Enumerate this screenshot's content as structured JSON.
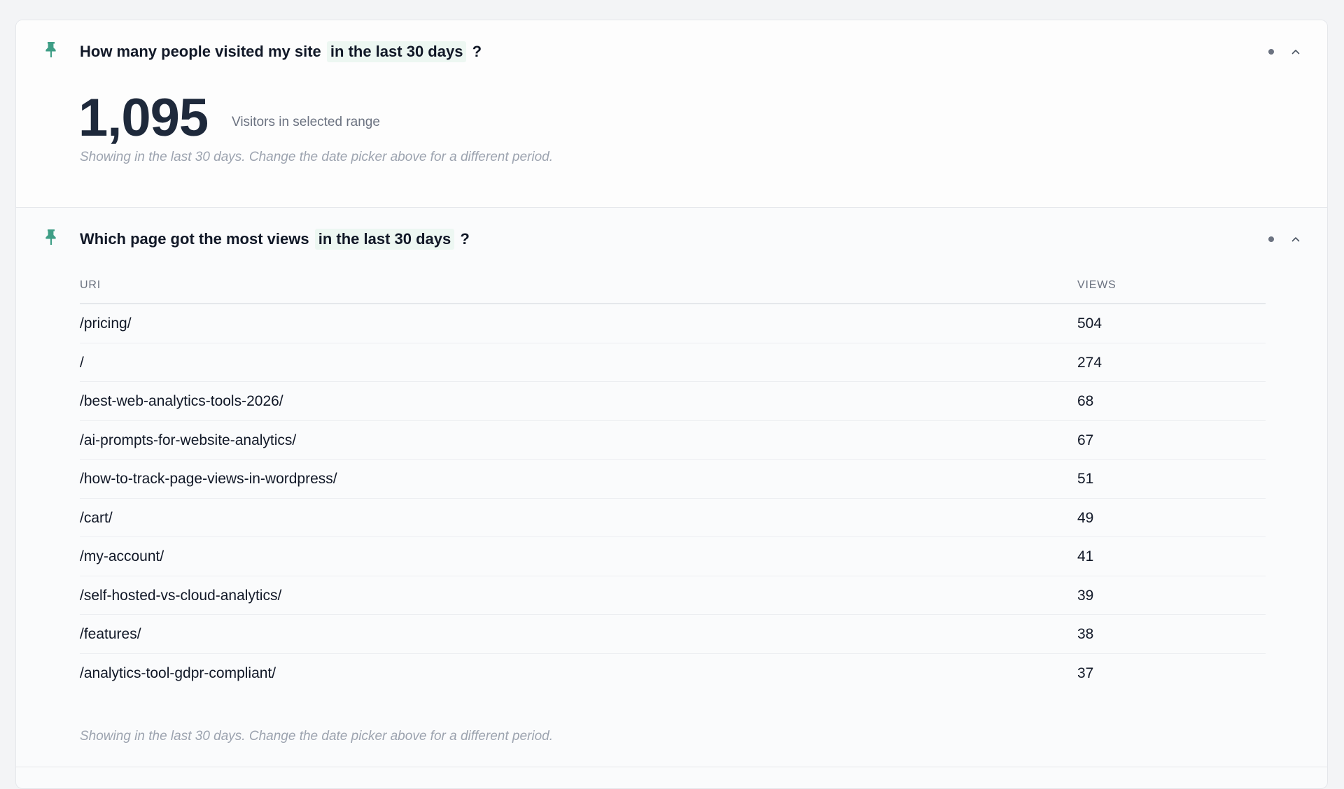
{
  "cards": [
    {
      "question_prefix": "How many people visited my site",
      "question_range": "in the last 30 days",
      "question_suffix": "?",
      "metric_value": "1,095",
      "metric_label": "Visitors in selected range",
      "footnote": "Showing in the last 30 days. Change the date picker above for a different period."
    },
    {
      "question_prefix": "Which page got the most views",
      "question_range": "in the last 30 days",
      "question_suffix": "?",
      "table": {
        "columns": [
          "URI",
          "VIEWS"
        ],
        "rows": [
          {
            "uri": "/pricing/",
            "views": "504"
          },
          {
            "uri": "/",
            "views": "274"
          },
          {
            "uri": "/best-web-analytics-tools-2026/",
            "views": "68"
          },
          {
            "uri": "/ai-prompts-for-website-analytics/",
            "views": "67"
          },
          {
            "uri": "/how-to-track-page-views-in-wordpress/",
            "views": "51"
          },
          {
            "uri": "/cart/",
            "views": "49"
          },
          {
            "uri": "/my-account/",
            "views": "41"
          },
          {
            "uri": "/self-hosted-vs-cloud-analytics/",
            "views": "39"
          },
          {
            "uri": "/features/",
            "views": "38"
          },
          {
            "uri": "/analytics-tool-gdpr-compliant/",
            "views": "37"
          }
        ]
      },
      "footnote": "Showing in the last 30 days. Change the date picker above for a different period."
    }
  ],
  "icons": {
    "pin": "pin-icon",
    "menu": "dot-menu-icon",
    "collapse": "chevron-up-icon"
  },
  "colors": {
    "pin": "#3f9e86",
    "range_highlight": "#edf7f2",
    "metric": "#1e293b",
    "muted": "#9ca3af"
  }
}
